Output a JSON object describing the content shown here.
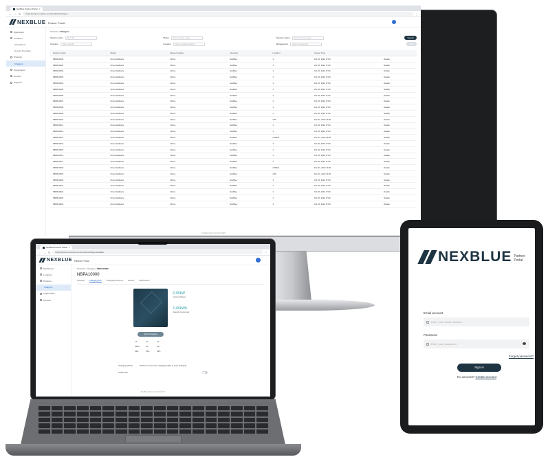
{
  "brand": "NEXBLUE",
  "portal": "Partner Portal",
  "monitor": {
    "tab_title": "NexBlue Partner Portal",
    "url": "https://partner.nexblue.com/products/chargers",
    "breadcrumb": [
      "Products",
      "Chargers"
    ],
    "sidebar": [
      {
        "label": "Dashboard",
        "sub": false,
        "active": false
      },
      {
        "label": "Locations",
        "sub": false,
        "active": false
      },
      {
        "label": "All locations",
        "sub": true,
        "active": false
      },
      {
        "label": "Groups & location",
        "sub": true,
        "active": false
      },
      {
        "label": "Products",
        "sub": false,
        "active": false
      },
      {
        "label": "Chargers",
        "sub": true,
        "active": true
      },
      {
        "label": "Organization",
        "sub": false,
        "active": false
      },
      {
        "label": "Account",
        "sub": false,
        "active": false
      },
      {
        "label": "Supports",
        "sub": false,
        "active": false
      }
    ],
    "filters": [
      {
        "label": "Serial number",
        "placeholder": "Enter SN"
      },
      {
        "label": "Model",
        "placeholder": "Select charger model"
      },
      {
        "label": "Network status",
        "placeholder": "Select network status"
      },
      {
        "label": "Operator",
        "placeholder": "Select operator"
      },
      {
        "label": "Location",
        "placeholder": "Select a location address"
      },
      {
        "label": "Management",
        "placeholder": "Select management"
      }
    ],
    "search_label": "Search",
    "clear_label": "Clear",
    "columns": [
      "Serial number",
      "Model",
      "Network status",
      "Operator",
      "Location",
      "Create Time",
      ""
    ],
    "rows": [
      [
        "NBPA10000",
        "Circuit Hallmarv",
        "Online",
        "NexBlue",
        "1",
        "Oct 20, 2022 17:00",
        "Details"
      ],
      [
        "NBPA10001",
        "Circuit Hallmarv",
        "Online",
        "NexBlue",
        "1",
        "Oct 20, 2022 17:00",
        "Details"
      ],
      [
        "NBPA10002",
        "Circuit Hallmarv",
        "Online",
        "NexBlue",
        "1",
        "Oct 20, 2022 17:00",
        "Details"
      ],
      [
        "NBPA10003",
        "Circuit Hallmarv",
        "Online",
        "NexBlue",
        "1",
        "Oct 20, 2022 17:00",
        "Details"
      ],
      [
        "NBPA10004",
        "Circuit Hallmarv",
        "Online",
        "NexBlue",
        "1",
        "Oct 20, 2022 17:00",
        "Details"
      ],
      [
        "NBPA10005",
        "Circuit Hallmarv",
        "Online",
        "NexBlue",
        "1",
        "Oct 20, 2022 17:00",
        "Details"
      ],
      [
        "NBPA10006",
        "Circuit Hallmarv",
        "Online",
        "NexBlue",
        "1",
        "Oct 20, 2022 17:00",
        "Details"
      ],
      [
        "NBPA10007",
        "Circuit Hallmarv",
        "Online",
        "NexBlue",
        "1",
        "Oct 20, 2022 17:00",
        "Details"
      ],
      [
        "NBPA10008",
        "Circuit Hallmarv",
        "Online",
        "NexBlue",
        "1",
        "Oct 20, 2022 17:00",
        "Details"
      ],
      [
        "NBPA10009",
        "Circuit Hallmarv",
        "Online",
        "NexBlue",
        "1",
        "Oct 20, 2022 17:00",
        "Details"
      ],
      [
        "NBPA10010",
        "Circuit Hallmarv",
        "Online",
        "NexBlue",
        "sf7b",
        "Nov 01, 2022 13:00",
        "Details"
      ],
      [
        "NBPA10011",
        "Circuit Hallmarv",
        "Online",
        "NexBlue",
        "1",
        "Oct 20, 2022 17:00",
        "Details"
      ],
      [
        "NBPA10012",
        "Circuit Hallmarv",
        "Online",
        "NexBlue",
        "1",
        "Oct 20, 2022 17:00",
        "Details"
      ],
      [
        "NBPA10013",
        "Circuit Hallmarv",
        "Online",
        "NexBlue",
        "sf7b6e4",
        "Nov 01, 2022 13:00",
        "Details"
      ],
      [
        "NBPA10014",
        "Circuit Hallmarv",
        "Online",
        "NexBlue",
        "1",
        "Oct 20, 2022 17:00",
        "Details"
      ],
      [
        "NBPA10015",
        "Circuit Hallmarv",
        "Online",
        "NexBlue",
        "1",
        "Oct 20, 2022 17:00",
        "Details"
      ],
      [
        "NBPA10016",
        "Circuit Hallmarv",
        "Online",
        "NexBlue",
        "1",
        "Oct 20, 2022 17:00",
        "Details"
      ],
      [
        "NBPA10017",
        "Circuit Hallmarv",
        "Online",
        "NexBlue",
        "1",
        "Oct 20, 2022 17:00",
        "Details"
      ],
      [
        "NBPA10018",
        "Circuit Hallmarv",
        "Online",
        "NexBlue",
        "sf7b6e4",
        "Nov 01, 2022 13:00",
        "Details"
      ],
      [
        "NBPA10019",
        "Circuit Hallmarv",
        "Online",
        "NexBlue",
        "sf7b",
        "Nov 01, 2022 13:00",
        "Details"
      ],
      [
        "NBPA10020",
        "Circuit Hallmarv",
        "Online",
        "NexBlue",
        "1",
        "Oct 20, 2022 17:00",
        "Details"
      ],
      [
        "NBPA10021",
        "Circuit Hallmarv",
        "Online",
        "NexBlue",
        "1",
        "Oct 20, 2022 17:00",
        "Details"
      ],
      [
        "NBPA10022",
        "Circuit Hallmarv",
        "Online",
        "NexBlue",
        "1",
        "Oct 20, 2022 17:00",
        "Details"
      ],
      [
        "NBPA10023",
        "Circuit Hallmarv",
        "Online",
        "NexBlue",
        "1",
        "Oct 20, 2022 17:00",
        "Details"
      ],
      [
        "NBPA10024",
        "Circuit Hallmarv",
        "Online",
        "NexBlue",
        "1",
        "Oct 20, 2022 17:00",
        "Details"
      ]
    ],
    "footer": "NexBlue Partner Portal ©2022"
  },
  "laptop": {
    "tab_title": "NexBlue Partner Portal",
    "url": "https://partner.nexblue.com/products/chargers/details",
    "breadcrumb": [
      "Products",
      "Chargers",
      "NBPA10000"
    ],
    "sidebar": [
      {
        "label": "Dashboard",
        "sub": false,
        "active": false
      },
      {
        "label": "Locations",
        "sub": false,
        "active": false
      },
      {
        "label": "Products",
        "sub": false,
        "active": false
      },
      {
        "label": "Chargers",
        "sub": true,
        "active": true
      },
      {
        "label": "Organization",
        "sub": false,
        "active": false
      },
      {
        "label": "Account",
        "sub": false,
        "active": false
      }
    ],
    "title": "NBPA10000",
    "tabs": [
      "General",
      "Charging info",
      "Charging sessions",
      "Events",
      "Distributors"
    ],
    "kpi1_value": "0.00kW",
    "kpi1_label": "Current Power",
    "kpi2_value": "0.00kWh",
    "kpi2_label": "Energy Consumed",
    "start_label": "Start Charging",
    "metrics": [
      "L1",
      "L2",
      "L3",
      "220V",
      "0V",
      "0V",
      "32A",
      "16A",
      "32A"
    ],
    "status_label": "Charging status",
    "status_value": "Please connect the charging cable to start charging",
    "lock_label": "Cable lock",
    "footer": "NexBlue Partner Portal ©2022"
  },
  "tablet": {
    "email_label": "Email account",
    "email_placeholder": "Enter your email address",
    "password_label": "Password",
    "password_placeholder": "Enter your password",
    "forgot": "Forget password?",
    "signin": "Sign in",
    "no_account": "No account?",
    "create": "Create account"
  }
}
